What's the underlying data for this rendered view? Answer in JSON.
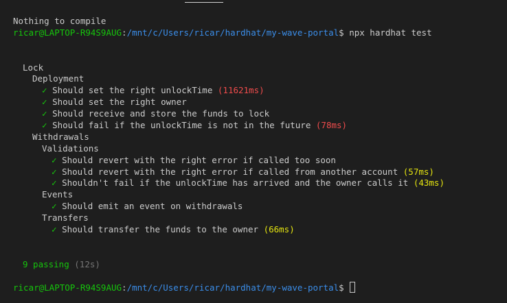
{
  "colors": {
    "background": "#1e1e1e",
    "text": "#cccccc",
    "prompt_user": "#16c60c",
    "prompt_path": "#3b8eea",
    "check": "#16c60c",
    "slow_duration": "#f14c4c",
    "medium_duration": "#e5e510"
  },
  "compile_message": "Nothing to compile",
  "prompt": {
    "user_host": "ricar@LAPTOP-R94S9AUG",
    "separator": ":",
    "path": "/mnt/c/Users/ricar/hardhat/my-wave-portal",
    "symbol": "$",
    "command": " npx hardhat test"
  },
  "suite": {
    "name": "Lock",
    "groups": [
      {
        "name": "Deployment",
        "tests": [
          {
            "check": "✓",
            "title": "Should set the right unlockTime",
            "duration": "(11621ms)"
          },
          {
            "check": "✓",
            "title": "Should set the right owner",
            "duration": ""
          },
          {
            "check": "✓",
            "title": "Should receive and store the funds to lock",
            "duration": ""
          },
          {
            "check": "✓",
            "title": "Should fail if the unlockTime is not in the future",
            "duration": "(78ms)"
          }
        ]
      },
      {
        "name": "Withdrawals",
        "subgroups": [
          {
            "name": "Validations",
            "tests": [
              {
                "check": "✓",
                "title": "Should revert with the right error if called too soon",
                "duration": ""
              },
              {
                "check": "✓",
                "title": "Should revert with the right error if called from another account",
                "duration": "(57ms)"
              },
              {
                "check": "✓",
                "title": "Shouldn't fail if the unlockTime has arrived and the owner calls it",
                "duration": "(43ms)"
              }
            ]
          },
          {
            "name": "Events",
            "tests": [
              {
                "check": "✓",
                "title": "Should emit an event on withdrawals",
                "duration": ""
              }
            ]
          },
          {
            "name": "Transfers",
            "tests": [
              {
                "check": "✓",
                "title": "Should transfer the funds to the owner",
                "duration": "(66ms)"
              }
            ]
          }
        ]
      }
    ]
  },
  "summary": {
    "passing": "9 passing",
    "time": "(12s)"
  },
  "final_prompt": {
    "user_host": "ricar@LAPTOP-R94S9AUG",
    "separator": ":",
    "path": "/mnt/c/Users/ricar/hardhat/my-wave-portal",
    "symbol": "$"
  }
}
